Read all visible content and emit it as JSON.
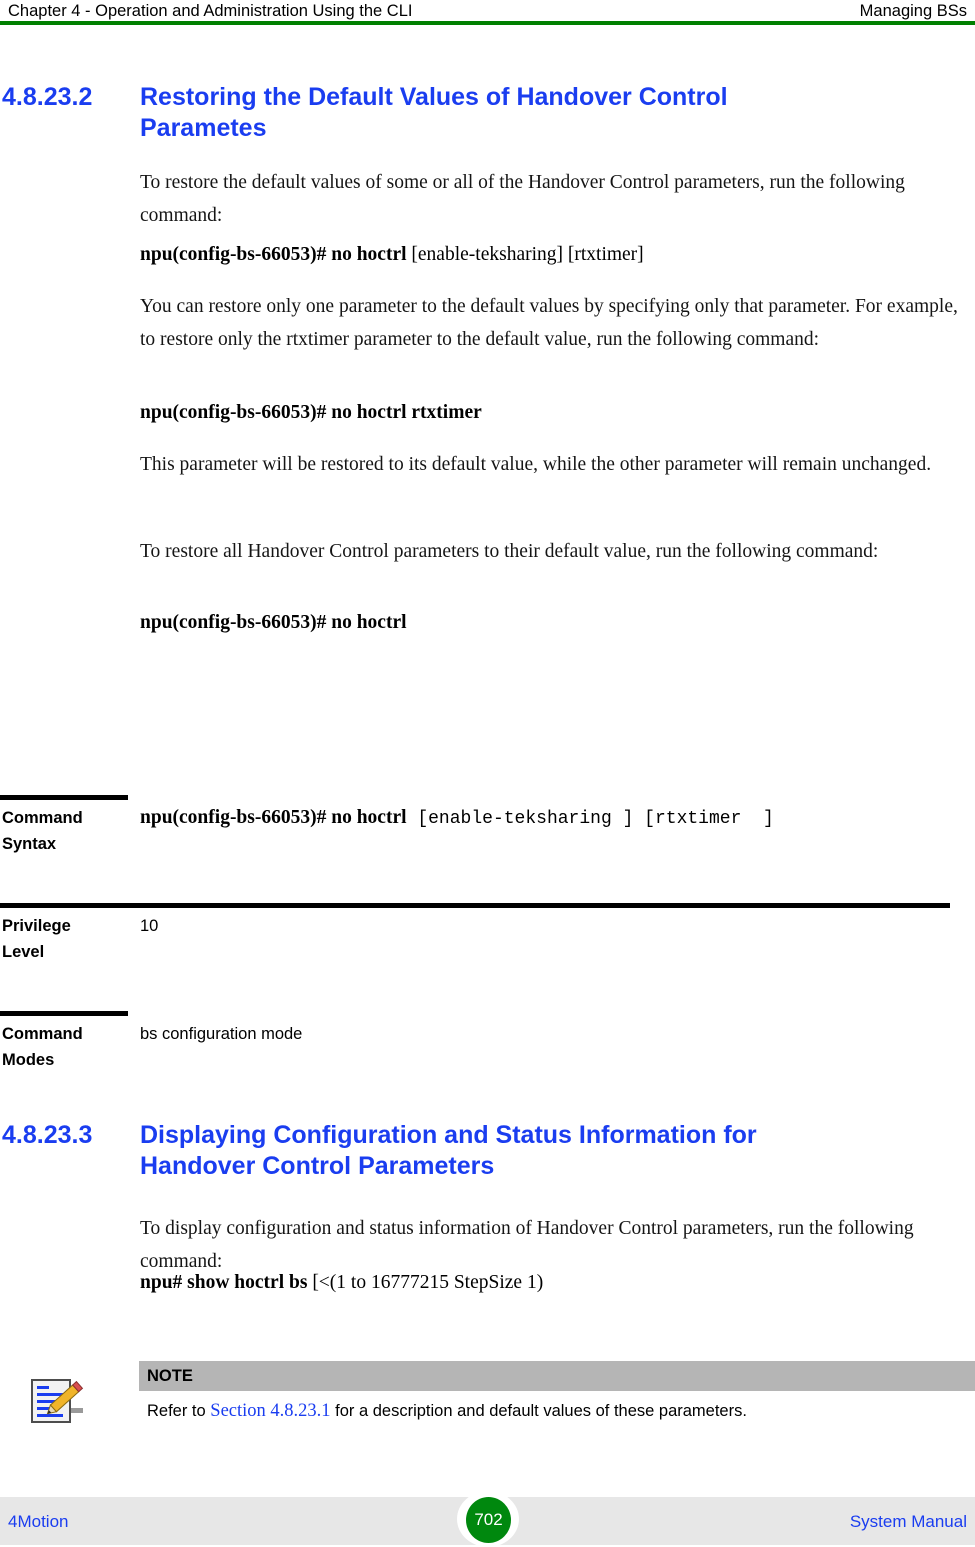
{
  "header": {
    "left": "Chapter 4 - Operation and Administration Using the CLI",
    "right": "Managing BSs",
    "rule_color": "#008000"
  },
  "sections": [
    {
      "number": "4.8.23.2",
      "title": "Restoring the Default Values of Handover Control Parametes"
    },
    {
      "number": "4.8.23.3",
      "title": "Displaying Configuration and Status Information for Handover Control Parameters"
    }
  ],
  "paragraphs": {
    "p1": "To restore the default values of some or all of the Handover Control parameters, run the following command:",
    "p2": "You can restore only one parameter to the default values by specifying only that parameter. For example, to restore only the rtxtimer parameter to the default value, run the following command:",
    "p3": "This parameter will be restored to its default value, while the other parameter will remain unchanged.",
    "p4": "To restore all Handover Control parameters to their default value, run the following command:",
    "p5": "To display configuration and status information of Handover Control parameters, run the following command:"
  },
  "commands": {
    "cmd1_bold": "npu(config-bs-66053)# no hoctrl",
    "cmd1_args": " [enable-teksharing] [rtxtimer]",
    "cmd2_bold": "npu(config-bs-66053)# no hoctrl  rtxtimer",
    "cmd3_bold": "npu(config-bs-66053)# no hoctrl",
    "cmd4_bold": "npu# show hoctrl bs",
    "cmd4_args": " [<(1 to 16777215 StepSize 1)"
  },
  "note": {
    "icon": "notepad-pencil-icon",
    "title": "NOTE",
    "text_before": "Refer to ",
    "link": "Section 4.8.23.1",
    "text_after": " for a description and default values of these parameters.",
    "bar_color": "#b5b5b5",
    "link_color": "#1a3df0"
  },
  "command_table": [
    {
      "label_line1": "Command",
      "label_line2": "Syntax",
      "value_bold": "npu(config-bs-66053)# no hoctrl",
      "value_mono": " [enable-teksharing ] [rtxtimer  ]"
    },
    {
      "label_line1": "Privilege",
      "label_line2": "Level",
      "value_plain": "10"
    },
    {
      "label_line1": "Command",
      "label_line2": "Modes",
      "value_plain": "bs configuration mode"
    }
  ],
  "footer": {
    "left": "4Motion",
    "page": "702",
    "right": "System Manual",
    "band_color": "#e7e7e7",
    "badge_color": "#00880e",
    "link_color": "#1a3df0"
  }
}
